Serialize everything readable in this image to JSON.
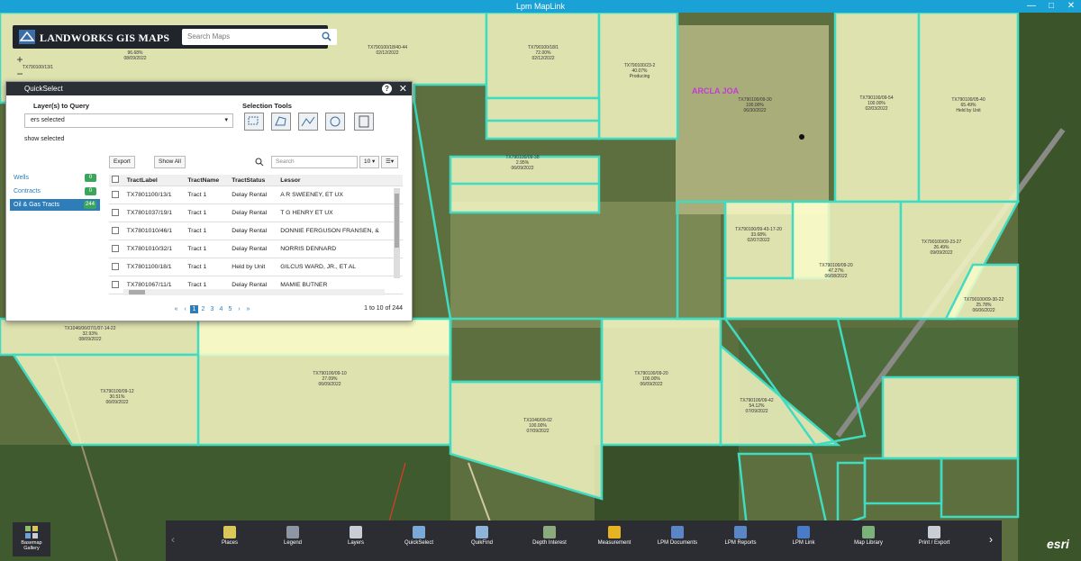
{
  "window": {
    "title": "Lpm MapLink",
    "controls": [
      "—",
      "□",
      "✕"
    ]
  },
  "header": {
    "app_name": "LANDWORKS GIS MAPS",
    "search_placeholder": "Search Maps"
  },
  "map": {
    "zoom_controls": [
      "+",
      "−",
      "‹",
      "›",
      "⟲"
    ],
    "overlay_text": "ARCLA JOA",
    "parcels": [
      {
        "l1": "TX790100/13/1",
        "l2": "96.68%",
        "l3": "08/09/2022"
      },
      {
        "l1": "TX790100/18/1",
        "l2": "72.00%",
        "l3": "02/12/2022"
      },
      {
        "l1": "TX790100/18/40-44",
        "l2": "",
        "l3": "02/12/2022"
      },
      {
        "l1": "TX790100/23-2",
        "l2": "40.07%",
        "l3": "Producing"
      },
      {
        "l1": "TX790100/09-30",
        "l2": "100.00%",
        "l3": "06/30/2022"
      },
      {
        "l1": "TX790100/09-54",
        "l2": "100.00%",
        "l3": "02/03/2022"
      },
      {
        "l1": "TX790100/05-40",
        "l2": "65.49%",
        "l3": "Held by Unit"
      },
      {
        "l1": "TX790100/09-43-17-20",
        "l2": "33.68%",
        "l3": "02/07/2022"
      },
      {
        "l1": "TX790100/09-20",
        "l2": "47.27%",
        "l3": "06/08/2022"
      },
      {
        "l1": "TX790100/09-23-27",
        "l2": "26.49%",
        "l3": "09/09/2022"
      },
      {
        "l1": "TX790100/09-30-22",
        "l2": "25.78%",
        "l3": "06/06/2022"
      },
      {
        "l1": "TX1046/06/07/1/07-14-22",
        "l2": "32.93%",
        "l3": "08/09/2022"
      },
      {
        "l1": "TX790100/09-12",
        "l2": "30.51%",
        "l3": "06/09/2022"
      },
      {
        "l1": "TX790100/09-10",
        "l2": "27.09%",
        "l3": "06/09/2022"
      },
      {
        "l1": "TX790100/09-20",
        "l2": "100.00%",
        "l3": "06/09/2022"
      },
      {
        "l1": "TX790100/09-42",
        "l2": "54.12%",
        "l3": "07/09/2022"
      },
      {
        "l1": "TX1046/09-02",
        "l2": "100.00%",
        "l3": "07/09/2022"
      },
      {
        "l1": "TX790100/09-38",
        "l2": "2.95%",
        "l3": "06/09/2022"
      }
    ]
  },
  "panel": {
    "title": "QuickSelect",
    "layers_label": "Layer(s) to Query",
    "layers_value": "ers selected",
    "selection_tools_label": "Selection Tools",
    "show_selected": "show selected",
    "layers": [
      {
        "name": "Wells",
        "count": "0",
        "selected": false
      },
      {
        "name": "Contracts",
        "count": "0",
        "selected": false
      },
      {
        "name": "Oil & Gas Tracts",
        "count": "244",
        "selected": true
      }
    ],
    "export_label": "Export",
    "show_all_label": "Show All",
    "search_placeholder": "Search",
    "page_size": "10",
    "columns": [
      "TractLabel",
      "TractName",
      "TractStatus",
      "Lessor"
    ],
    "rows": [
      [
        "TX7801100/13/1",
        "Tract 1",
        "Delay Rental",
        "A R SWEENEY, ET UX"
      ],
      [
        "TX7801037/19/1",
        "Tract 1",
        "Delay Rental",
        "T G HENRY ET UX"
      ],
      [
        "TX7801010/46/1",
        "Tract 1",
        "Delay Rental",
        "DONNIE FERGUSON FRANSEN, &"
      ],
      [
        "TX7801010/32/1",
        "Tract 1",
        "Delay Rental",
        "NORRIS DENNARD"
      ],
      [
        "TX7801100/18/1",
        "Tract 1",
        "Held by Unit",
        "GILCUS WARD, JR., ET AL"
      ],
      [
        "TX7801067/11/1",
        "Tract 1",
        "Delay Rental",
        "MAMIE BUTNER"
      ]
    ],
    "pages": [
      "«",
      "‹",
      "1",
      "2",
      "3",
      "4",
      "5",
      "›",
      "»"
    ],
    "current_page": "1",
    "page_count_text": "1 to 10 of 244"
  },
  "toolbar": {
    "items": [
      {
        "label": "Places",
        "color": "#d9c75a"
      },
      {
        "label": "Legend",
        "color": "#8e95a3"
      },
      {
        "label": "Layers",
        "color": "#c9ced6"
      },
      {
        "label": "QuickSelect",
        "color": "#7aa9d6"
      },
      {
        "label": "QuikFind",
        "color": "#8eb4d9"
      },
      {
        "label": "Depth Interest",
        "color": "#8cab7d"
      },
      {
        "label": "Measurement",
        "color": "#e6b422"
      },
      {
        "label": "LPM Documents",
        "color": "#5b86c5"
      },
      {
        "label": "LPM Reports",
        "color": "#5b86c5"
      },
      {
        "label": "LPM Link",
        "color": "#4a7bc8"
      },
      {
        "label": "Map Library",
        "color": "#7ab27a"
      },
      {
        "label": "Print / Export",
        "color": "#c9ced6"
      }
    ]
  },
  "basemap_label": "Basemap Gallery",
  "attribution": "esri"
}
